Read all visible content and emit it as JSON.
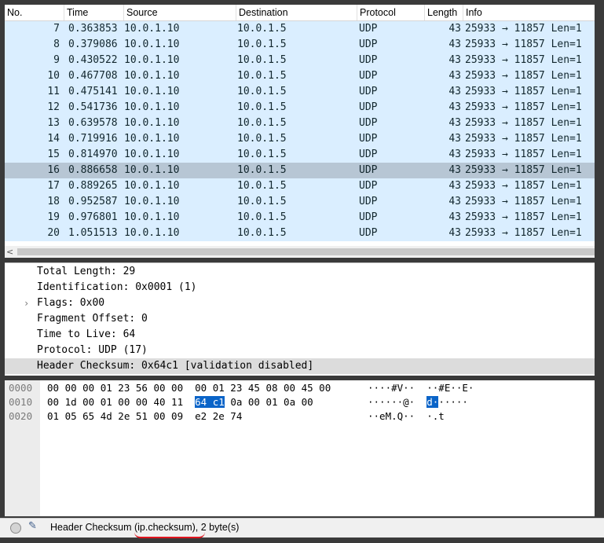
{
  "columns": [
    "No.",
    "Time",
    "Source",
    "Destination",
    "Protocol",
    "Length",
    "Info"
  ],
  "packets": [
    {
      "no": "7",
      "time": "0.363853",
      "src": "10.0.1.10",
      "dst": "10.0.1.5",
      "proto": "UDP",
      "len": "43",
      "info": "25933 → 11857 Len=1"
    },
    {
      "no": "8",
      "time": "0.379086",
      "src": "10.0.1.10",
      "dst": "10.0.1.5",
      "proto": "UDP",
      "len": "43",
      "info": "25933 → 11857 Len=1"
    },
    {
      "no": "9",
      "time": "0.430522",
      "src": "10.0.1.10",
      "dst": "10.0.1.5",
      "proto": "UDP",
      "len": "43",
      "info": "25933 → 11857 Len=1"
    },
    {
      "no": "10",
      "time": "0.467708",
      "src": "10.0.1.10",
      "dst": "10.0.1.5",
      "proto": "UDP",
      "len": "43",
      "info": "25933 → 11857 Len=1"
    },
    {
      "no": "11",
      "time": "0.475141",
      "src": "10.0.1.10",
      "dst": "10.0.1.5",
      "proto": "UDP",
      "len": "43",
      "info": "25933 → 11857 Len=1"
    },
    {
      "no": "12",
      "time": "0.541736",
      "src": "10.0.1.10",
      "dst": "10.0.1.5",
      "proto": "UDP",
      "len": "43",
      "info": "25933 → 11857 Len=1"
    },
    {
      "no": "13",
      "time": "0.639578",
      "src": "10.0.1.10",
      "dst": "10.0.1.5",
      "proto": "UDP",
      "len": "43",
      "info": "25933 → 11857 Len=1"
    },
    {
      "no": "14",
      "time": "0.719916",
      "src": "10.0.1.10",
      "dst": "10.0.1.5",
      "proto": "UDP",
      "len": "43",
      "info": "25933 → 11857 Len=1"
    },
    {
      "no": "15",
      "time": "0.814970",
      "src": "10.0.1.10",
      "dst": "10.0.1.5",
      "proto": "UDP",
      "len": "43",
      "info": "25933 → 11857 Len=1"
    },
    {
      "no": "16",
      "time": "0.886658",
      "src": "10.0.1.10",
      "dst": "10.0.1.5",
      "proto": "UDP",
      "len": "43",
      "info": "25933 → 11857 Len=1",
      "selected": true
    },
    {
      "no": "17",
      "time": "0.889265",
      "src": "10.0.1.10",
      "dst": "10.0.1.5",
      "proto": "UDP",
      "len": "43",
      "info": "25933 → 11857 Len=1"
    },
    {
      "no": "18",
      "time": "0.952587",
      "src": "10.0.1.10",
      "dst": "10.0.1.5",
      "proto": "UDP",
      "len": "43",
      "info": "25933 → 11857 Len=1"
    },
    {
      "no": "19",
      "time": "0.976801",
      "src": "10.0.1.10",
      "dst": "10.0.1.5",
      "proto": "UDP",
      "len": "43",
      "info": "25933 → 11857 Len=1"
    },
    {
      "no": "20",
      "time": "1.051513",
      "src": "10.0.1.10",
      "dst": "10.0.1.5",
      "proto": "UDP",
      "len": "43",
      "info": "25933 → 11857 Len=1"
    }
  ],
  "scroll_arrow": "<",
  "details": [
    {
      "text": "Total Length: 29"
    },
    {
      "text": "Identification: 0x0001 (1)"
    },
    {
      "text": "Flags: 0x00",
      "expandable": true,
      "expander": "›"
    },
    {
      "text": "Fragment Offset: 0"
    },
    {
      "text": "Time to Live: 64"
    },
    {
      "text": "Protocol: UDP (17)"
    },
    {
      "text": "Header Checksum: 0x64c1 [validation disabled]",
      "selected": true
    }
  ],
  "bytes": [
    {
      "offset": "0000",
      "hex_pre": "00 00 00 01 23 56 00 00  00 01 23 45 08 00 45 00",
      "hex_hl": "",
      "hex_post": "",
      "ascii_pre": "····#V··  ··#E··E·",
      "ascii_hl": "",
      "ascii_post": ""
    },
    {
      "offset": "0010",
      "hex_pre": "00 1d 00 01 00 00 40 11  ",
      "hex_hl": "64 c1",
      "hex_post": " 0a 00 01 0a 00",
      "ascii_pre": "······@·  ",
      "ascii_hl": "d·",
      "ascii_post": "·····"
    },
    {
      "offset": "0020",
      "hex_pre": "01 05 65 4d 2e 51 00 09  e2 2e 74",
      "hex_hl": "",
      "hex_post": "",
      "ascii_pre": "··eM.Q··  ·.t",
      "ascii_hl": "",
      "ascii_post": ""
    }
  ],
  "status": {
    "text": "Header Checksum (ip.checksum), 2 byte(s)",
    "indicator": "ready-icon",
    "edit_icon": "edit-note-icon"
  },
  "colors": {
    "row_bg": "#daeeff",
    "row_selected_bg": "#b7c6d4",
    "byte_highlight": "#0a64c8",
    "annotation_underline": "#e0141e"
  }
}
